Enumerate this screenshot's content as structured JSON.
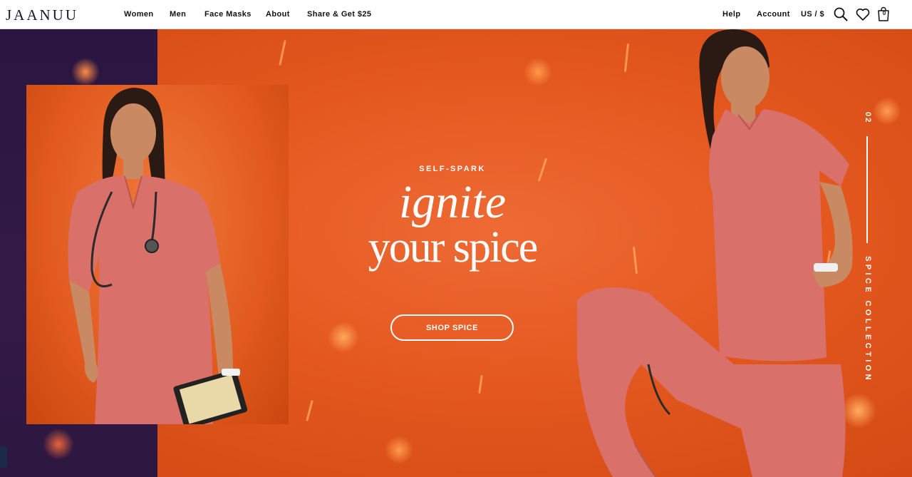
{
  "brand": {
    "logo_text": "JAANUU"
  },
  "nav": {
    "items": [
      {
        "label": "Women"
      },
      {
        "label": "Men"
      },
      {
        "label": "Face Masks"
      },
      {
        "label": "About"
      },
      {
        "label": "Share & Get $25"
      }
    ]
  },
  "utility": {
    "help": "Help",
    "account": "Account",
    "locale": "US / $",
    "cart_count": "0",
    "icons": [
      "search-icon",
      "heart-icon",
      "bag-icon"
    ]
  },
  "hero": {
    "eyebrow": "SELF-SPARK",
    "headline_line1": "ignite",
    "headline_line2": "your spice",
    "cta_label": "SHOP SPICE",
    "side_index": "02",
    "side_label": "SPICE COLLECTION"
  },
  "colors": {
    "hero_orange": "#e4581f",
    "side_band_purple": "#341a47",
    "scrub_color": "#d9706a",
    "text_white": "#ffffff"
  }
}
